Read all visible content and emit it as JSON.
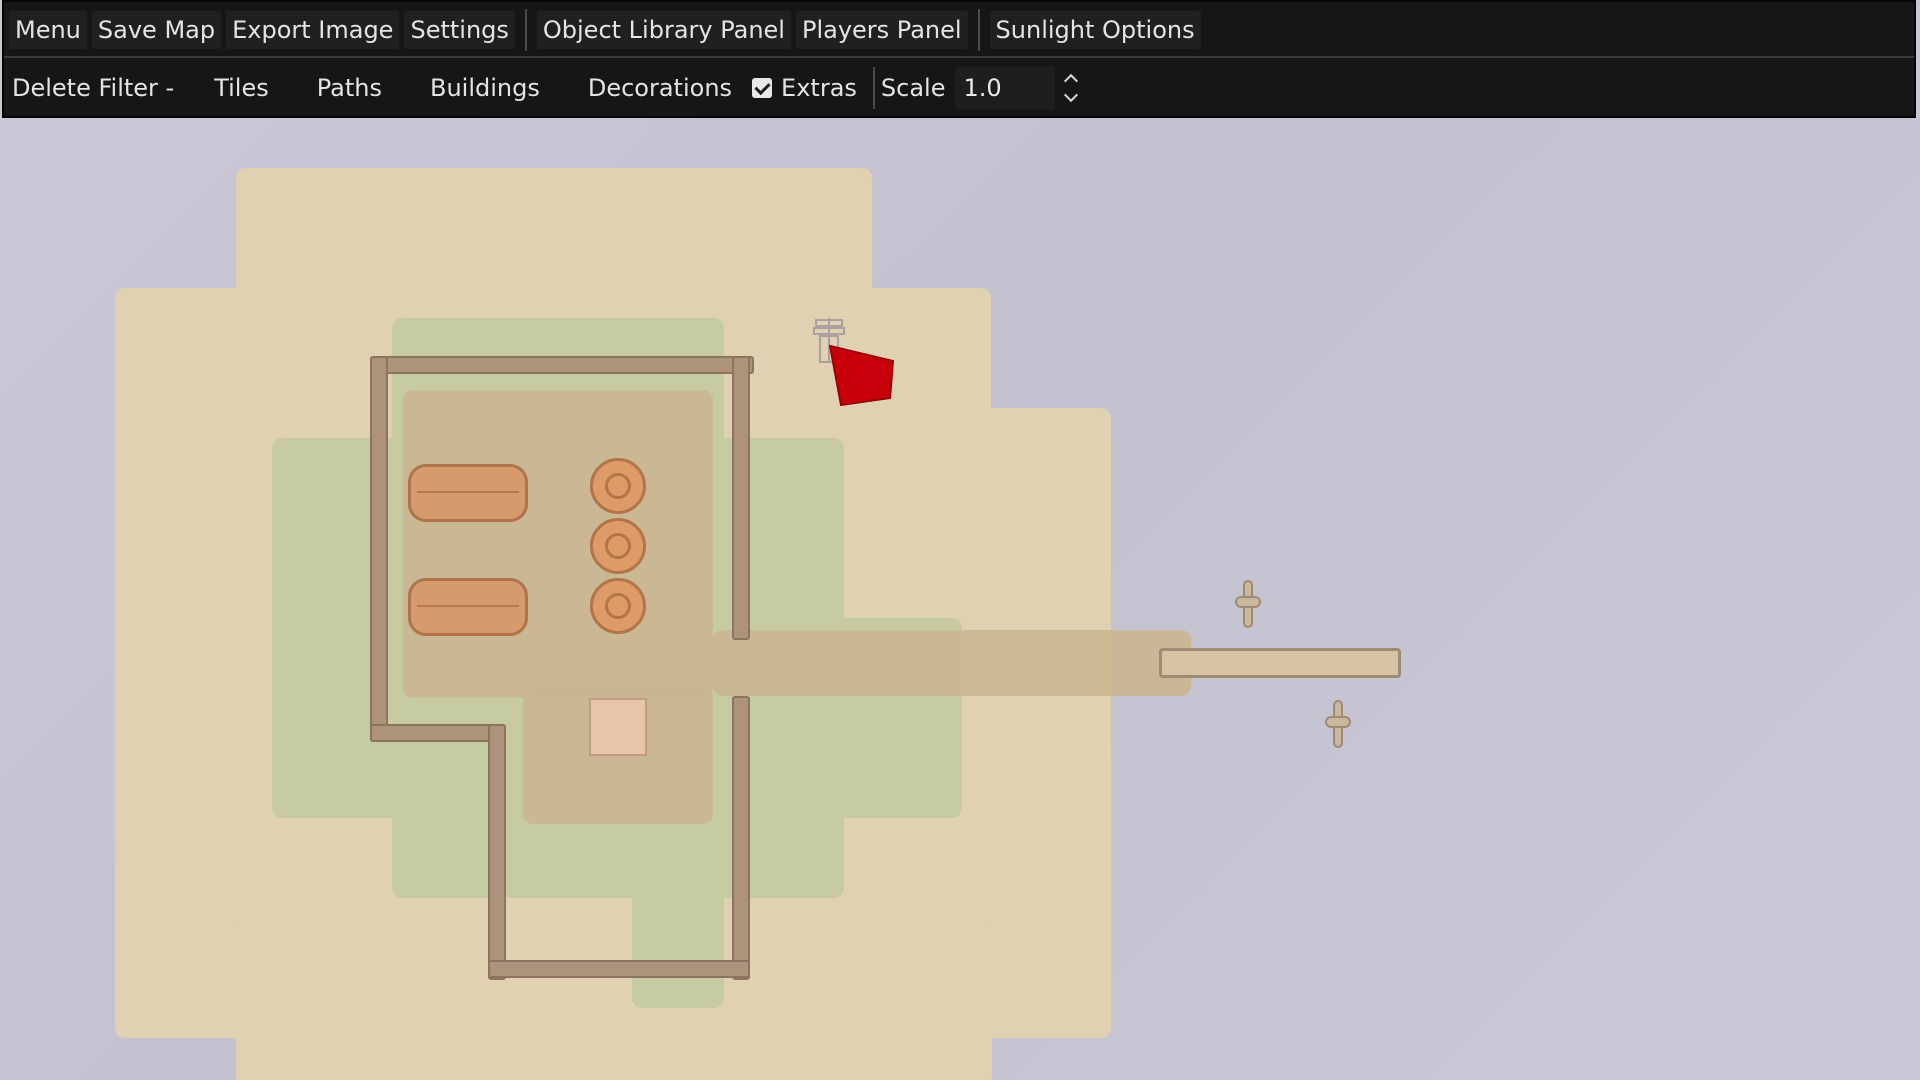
{
  "menubar": {
    "items": [
      "Menu",
      "Save Map",
      "Export Image",
      "Settings",
      "Object Library Panel",
      "Players Panel",
      "Sunlight Options"
    ]
  },
  "filterbar": {
    "delete_filter_label": "Delete Filter -",
    "filters": [
      "Tiles",
      "Paths",
      "Buildings",
      "Decorations"
    ],
    "extras_label": "Extras",
    "extras_checked": true,
    "scale_label": "Scale",
    "scale_value": "1.0"
  },
  "colors": {
    "toolbar_bg": "#161616",
    "canvas_bg": "#c9c6d3",
    "sand": "#dfd1b1",
    "grass": "#c6cba1",
    "path": "#c9b691",
    "stone_wall": "#b79b86",
    "wood": "#d79a6a",
    "player_marker": "#c8000a"
  },
  "icons": {
    "extras_checkbox": "checkmark-icon",
    "scale_up": "chevron-up-icon",
    "scale_down": "chevron-down-icon",
    "player_marker": "red-player-marker-icon",
    "small_tower": "pillar-icon"
  }
}
